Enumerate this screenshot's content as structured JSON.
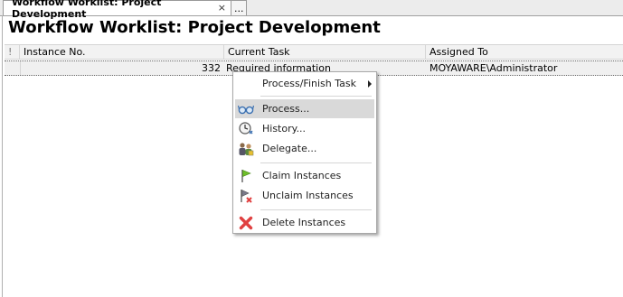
{
  "tabs": [
    {
      "label": "Workflow Worklist: Project Development",
      "close": "×"
    },
    {
      "label": "..."
    }
  ],
  "page_title": "Workflow Worklist: Project Development",
  "grid": {
    "flag_header": "!",
    "columns": [
      "Instance No.",
      "Current Task",
      "Assigned To"
    ],
    "rows": [
      {
        "instance": "332",
        "task": "Required information",
        "assigned": "MOYAWARE\\Administrator"
      }
    ]
  },
  "context_menu": {
    "items": [
      {
        "label": "Process/Finish Task",
        "icon": "none",
        "submenu": true
      },
      {
        "label": "Process...",
        "icon": "glasses-icon",
        "highlighted": true
      },
      {
        "label": "History...",
        "icon": "clock-icon"
      },
      {
        "label": "Delegate...",
        "icon": "users-icon"
      },
      {
        "label": "Claim Instances",
        "icon": "green-flag-icon"
      },
      {
        "label": "Unclaim Instances",
        "icon": "flag-red-x-icon"
      },
      {
        "label": "Delete Instances",
        "icon": "red-x-icon"
      }
    ]
  },
  "colors": {
    "highlight": "#d9d9d9",
    "delete_red": "#e04040",
    "flag_green": "#6fbf2a"
  }
}
